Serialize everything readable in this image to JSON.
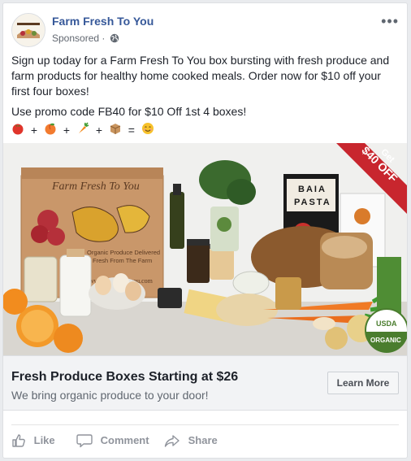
{
  "post": {
    "page_name": "Farm Fresh To You",
    "sponsored_label": "Sponsored",
    "body_paragraph_1": "Sign up today for a Farm Fresh To You box bursting with fresh produce and farm products for healthy home cooked meals. Order now for $10 off your first four boxes!",
    "body_paragraph_2": "Use promo code FB40 for $10 Off 1st 4 boxes!",
    "emoji_operators": [
      "+",
      "+",
      "+",
      "+",
      "="
    ]
  },
  "creative": {
    "box_brand": "Farm Fresh To You",
    "box_tagline_1": "Organic Produce Delivered",
    "box_tagline_2": "Fresh From The Farm",
    "box_url": "www.farmfreshtoyou.com",
    "banner_line_1": "Get",
    "banner_line_2": "$40 OFF",
    "pasta_brand_1": "BAIA",
    "pasta_brand_2": "PASTA",
    "seal_line_1": "USDA",
    "seal_line_2": "ORGANIC",
    "colors": {
      "banner": "#c8262e",
      "box": "#c9976a",
      "box_ink": "#5b3a22"
    }
  },
  "link": {
    "headline": "Fresh Produce Boxes Starting at $26",
    "description": "We bring organic produce to your door!",
    "cta_label": "Learn More"
  },
  "actions": {
    "like": "Like",
    "comment": "Comment",
    "share": "Share"
  },
  "colors": {
    "link_blue": "#365899",
    "muted": "#90949c"
  }
}
